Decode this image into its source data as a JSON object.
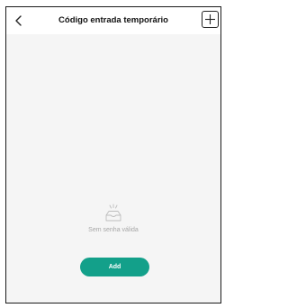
{
  "header": {
    "back_icon": "chevron-left-icon",
    "title": "Código entrada temporário",
    "add_icon": "plus-icon"
  },
  "empty_state": {
    "icon": "empty-inbox-icon",
    "message": "Sem senha válida"
  },
  "actions": {
    "add_label": "Add"
  },
  "colors": {
    "accent": "#13a08a",
    "background": "#f5f5f5",
    "header_background": "#ffffff",
    "muted_text": "#a6a6a6"
  }
}
